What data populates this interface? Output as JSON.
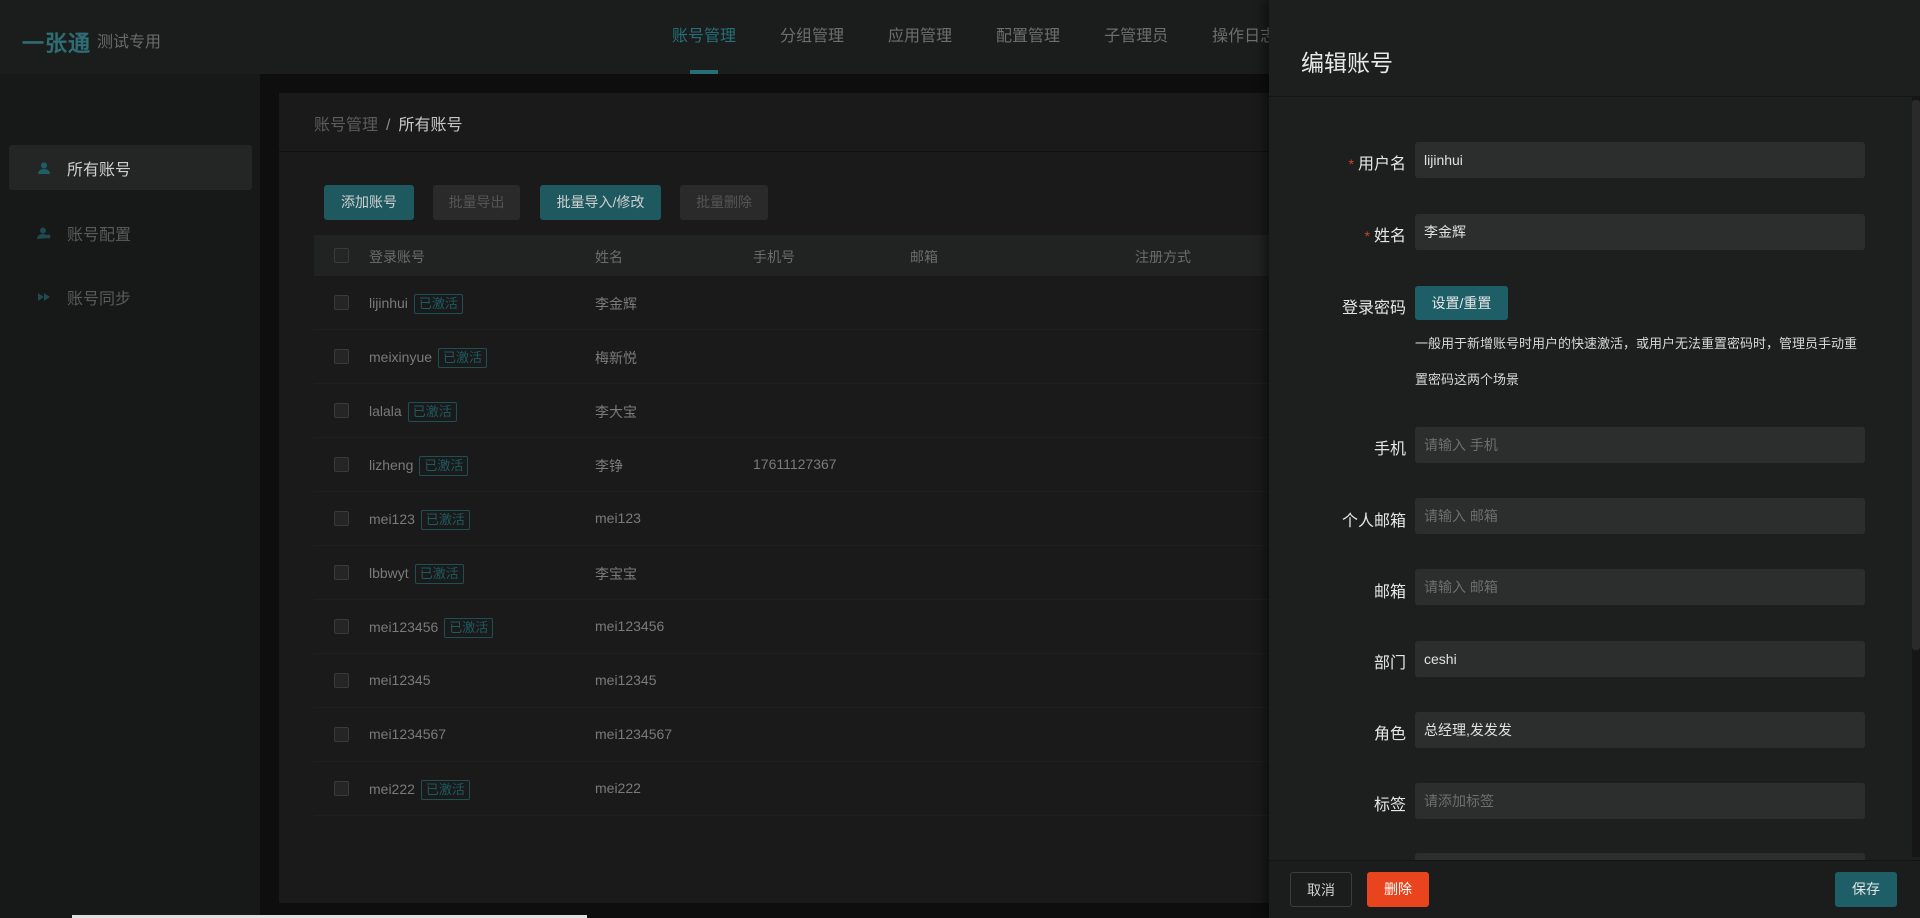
{
  "app": {
    "logo": "一张通",
    "subtitle": "测试专用"
  },
  "topnav": [
    {
      "label": "账号管理",
      "active": true
    },
    {
      "label": "分组管理"
    },
    {
      "label": "应用管理"
    },
    {
      "label": "配置管理"
    },
    {
      "label": "子管理员"
    },
    {
      "label": "操作日志"
    }
  ],
  "sidebar": {
    "items": [
      {
        "label": "所有账号",
        "icon": "user-icon",
        "active": true
      },
      {
        "label": "账号配置",
        "icon": "user-settings-icon"
      },
      {
        "label": "账号同步",
        "icon": "sync-icon"
      }
    ]
  },
  "breadcrumb": {
    "parent": "账号管理",
    "separator": "/",
    "current": "所有账号"
  },
  "toolbar": {
    "add": "添加账号",
    "export": "批量导出",
    "import": "批量导入/修改",
    "delete": "批量删除"
  },
  "table": {
    "columns": [
      "登录账号",
      "姓名",
      "手机号",
      "邮箱",
      "注册方式"
    ],
    "rows": [
      {
        "account": "lijinhui",
        "tag": "已激活",
        "name": "李金辉",
        "phone": ""
      },
      {
        "account": "meixinyue",
        "tag": "已激活",
        "name": "梅新悦",
        "phone": ""
      },
      {
        "account": "lalala",
        "tag": "已激活",
        "name": "李大宝",
        "phone": ""
      },
      {
        "account": "lizheng",
        "tag": "已激活",
        "name": "李铮",
        "phone": "17611127367"
      },
      {
        "account": "mei123",
        "tag": "已激活",
        "name": "mei123",
        "phone": ""
      },
      {
        "account": "lbbwyt",
        "tag": "已激活",
        "name": "李宝宝",
        "phone": ""
      },
      {
        "account": "mei123456",
        "tag": "已激活",
        "name": "mei123456",
        "phone": ""
      },
      {
        "account": "mei12345",
        "tag": "",
        "name": "mei12345",
        "phone": ""
      },
      {
        "account": "mei1234567",
        "tag": "",
        "name": "mei1234567",
        "phone": ""
      },
      {
        "account": "mei222",
        "tag": "已激活",
        "name": "mei222",
        "phone": ""
      }
    ]
  },
  "drawer": {
    "title": "编辑账号",
    "required_mark": "*",
    "fields": {
      "username": {
        "label": "用户名",
        "value": "lijinhui"
      },
      "fullname": {
        "label": "姓名",
        "value": "李金辉"
      },
      "password": {
        "label": "登录密码",
        "button": "设置/重置",
        "hint": "一般用于新增账号时用户的快速激活，或用户无法重置密码时，管理员手动重置密码这两个场景"
      },
      "phone": {
        "label": "手机",
        "placeholder": "请输入 手机"
      },
      "personal_email": {
        "label": "个人邮箱",
        "placeholder": "请输入 邮箱"
      },
      "email": {
        "label": "邮箱",
        "placeholder": "请输入 邮箱"
      },
      "department": {
        "label": "部门",
        "value": "ceshi"
      },
      "role": {
        "label": "角色",
        "value": "总经理,发发发"
      },
      "tags": {
        "label": "标签",
        "placeholder": "请添加标签"
      }
    },
    "footer": {
      "cancel": "取消",
      "delete": "删除",
      "save": "保存"
    }
  },
  "colors": {
    "accent": "#1e5e66",
    "danger": "#e8441e",
    "required": "#d0442a"
  }
}
